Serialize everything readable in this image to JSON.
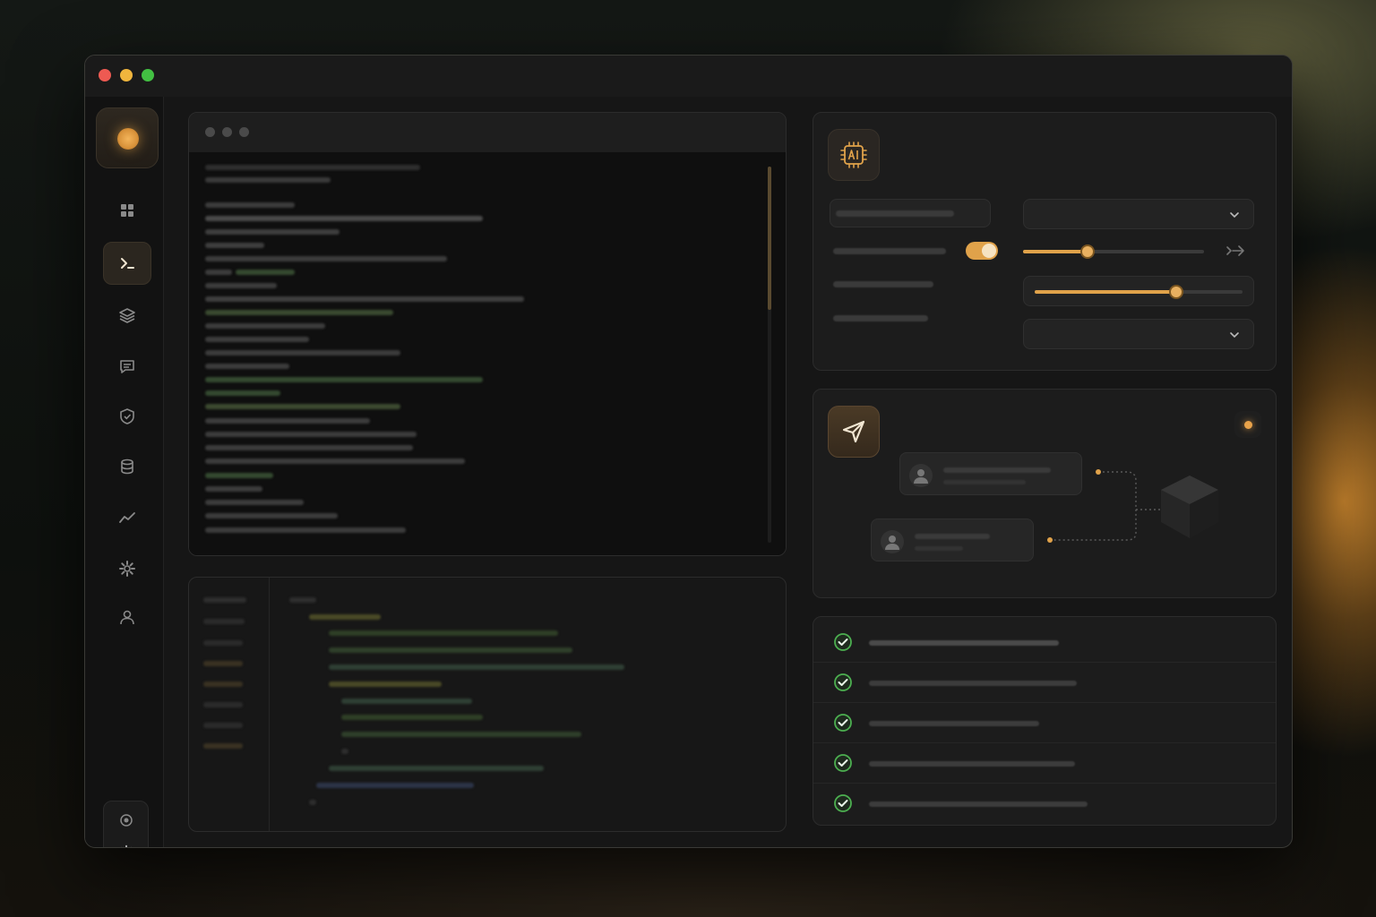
{
  "window": {
    "controls": [
      "close",
      "minimize",
      "maximize"
    ]
  },
  "colors": {
    "accent": "#e0a24a",
    "success": "#4caf50",
    "background": "#161616"
  },
  "sidebar": {
    "logo": "brand-orb-icon",
    "items": [
      {
        "icon": "grid-icon",
        "active": false
      },
      {
        "icon": "terminal-icon",
        "active": true
      },
      {
        "icon": "layers-icon",
        "active": false
      },
      {
        "icon": "chat-icon",
        "active": false
      },
      {
        "icon": "shield-icon",
        "active": false
      },
      {
        "icon": "database-icon",
        "active": false
      },
      {
        "icon": "analytics-icon",
        "active": false
      },
      {
        "icon": "gear-icon",
        "active": false
      },
      {
        "icon": "user-icon",
        "active": false
      }
    ],
    "theme": [
      "system-icon",
      "sun-icon"
    ]
  },
  "settings": {
    "icon": "ai-chip-icon",
    "toggle_on": true,
    "slider_1": 0.36,
    "slider_2": 0.68
  },
  "flow": {
    "icon": "send-icon",
    "status": "active"
  },
  "checklist": {
    "items_done": [
      true,
      true,
      true,
      true,
      true
    ]
  }
}
